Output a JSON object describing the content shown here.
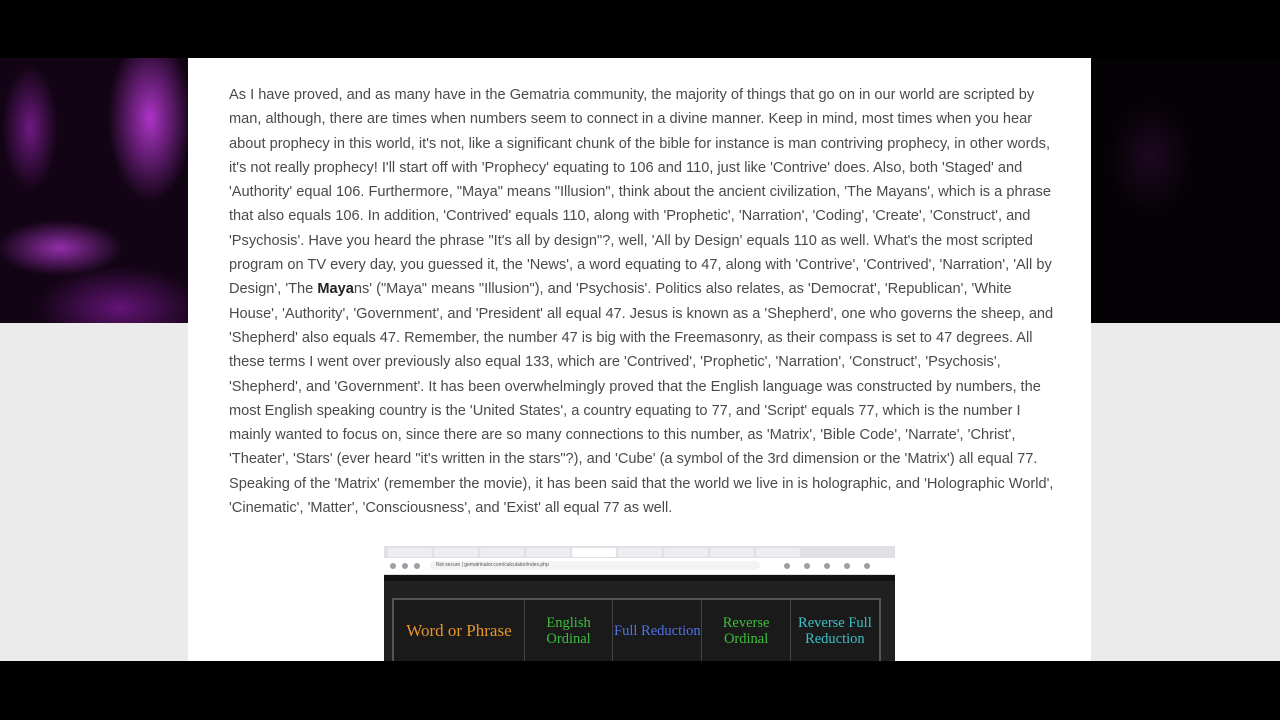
{
  "article": {
    "p1": "As I have proved, and as many have in the Gematria community, the majority of things that go on in our world are scripted by man, although, there are times when numbers seem to connect in a divine manner. Keep in mind, most times when you hear about prophecy in this world, it's not, like a significant chunk of the bible for instance is man contriving prophecy, in other words, it's not really prophecy! I'll start off with 'Prophecy' equating to 106 and 110, just like 'Contrive' does. Also, both 'Staged' and 'Authority' equal 106. Furthermore, \"Maya\" means \"Illusion\", think about the ancient civilization, 'The Mayans', which is a phrase that also equals 106. In addition, 'Contrived' equals 110, along with 'Prophetic', 'Narration', 'Coding', 'Create', 'Construct', and 'Psychosis'. Have you heard the phrase \"It's all by design\"?, well, 'All by Design' equals 110 as well. What's the most scripted program on TV every day, you guessed it, the 'News', a word equating to 47, along with 'Contrive', 'Contrived', 'Narration', 'All by Design', 'The ",
    "bold": "Maya",
    "p2": "ns' (\"Maya\" means \"Illusion\"), and 'Psychosis'. Politics also relates, as 'Democrat', 'Republican', 'White House', 'Authority', 'Government', and 'President' all equal 47. Jesus is known as a 'Shepherd', one who governs the sheep, and 'Shepherd' also equals 47. Remember, the number 47 is big with the Freemasonry, as their compass is set to 47 degrees. All these terms I went over previously also equal 133, which are 'Contrived', 'Prophetic', 'Narration', 'Construct', 'Psychosis', 'Shepherd', and 'Government'. It has been overwhelmingly proved that the English language was constructed by numbers, the most English speaking country is the 'United States', a country equating to 77, and 'Script' equals 77, which is the number I mainly wanted to focus on, since there are so many connections to this number, as 'Matrix', 'Bible Code', 'Narrate', 'Christ', 'Theater', 'Stars' (ever heard \"it's written in the stars\"?), and 'Cube' (a symbol of the 3rd dimension or the 'Matrix') all equal 77. Speaking of the 'Matrix' (remember the movie), it has been said that the world we live in is holographic, and 'Holographic World', 'Cinematic', 'Matter', 'Consciousness', and 'Exist' all equal 77 as well."
  },
  "embedded_screenshot": {
    "address": "Not secure | gematrinator.com/calculator/index.php",
    "table_headers": [
      "Word or Phrase",
      "English Ordinal",
      "Full Reduction",
      "Reverse Ordinal",
      "Reverse Full Reduction"
    ]
  }
}
